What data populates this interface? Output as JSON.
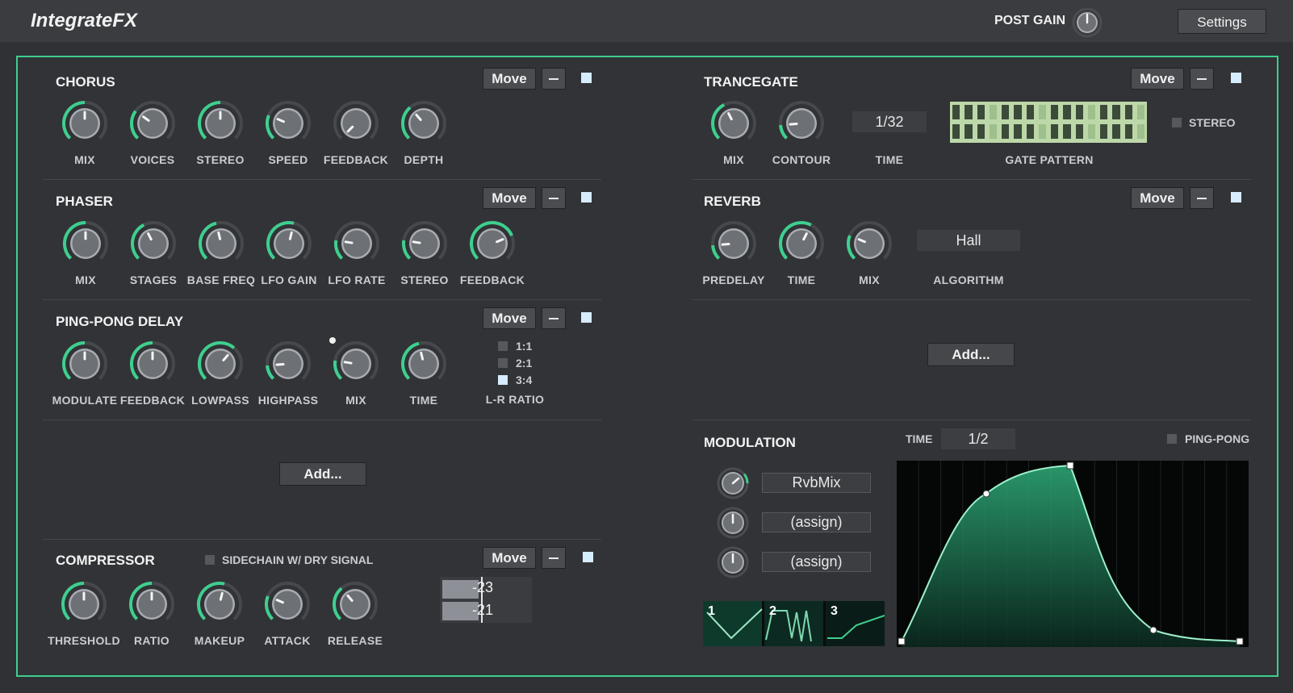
{
  "app": {
    "title": "IntegrateFX",
    "post_gain_label": "POST GAIN",
    "settings_label": "Settings"
  },
  "common": {
    "move_label": "Move",
    "add_label": "Add..."
  },
  "colors": {
    "accent": "#3ecf8e",
    "background": "#313337",
    "panel_border": "#3ecf8e"
  },
  "chorus": {
    "title": "CHORUS",
    "knobs": [
      "MIX",
      "VOICES",
      "STEREO",
      "SPEED",
      "FEEDBACK",
      "DEPTH"
    ],
    "values": [
      0.5,
      0.3,
      0.5,
      0.25,
      0.0,
      0.35
    ]
  },
  "phaser": {
    "title": "PHASER",
    "knobs": [
      "MIX",
      "STAGES",
      "BASE FREQ",
      "LFO GAIN",
      "LFO RATE",
      "STEREO",
      "FEEDBACK"
    ],
    "values": [
      0.5,
      0.4,
      0.45,
      0.55,
      0.2,
      0.2,
      0.75
    ]
  },
  "pingpong": {
    "title": "PING-PONG DELAY",
    "knobs": [
      "MODULATE",
      "FEEDBACK",
      "LOWPASS",
      "HIGHPASS",
      "MIX",
      "TIME"
    ],
    "values": [
      0.5,
      0.5,
      0.65,
      0.15,
      0.2,
      0.45
    ],
    "ratio_options": [
      "1:1",
      "2:1",
      "3:4"
    ],
    "ratio_selected": "3:4",
    "ratio_label": "L-R RATIO"
  },
  "compressor": {
    "title": "COMPRESSOR",
    "sidechain_label": "SIDECHAIN W/ DRY SIGNAL",
    "knobs": [
      "THRESHOLD",
      "RATIO",
      "MAKEUP",
      "ATTACK",
      "RELEASE"
    ],
    "values": [
      0.5,
      0.5,
      0.55,
      0.25,
      0.35
    ],
    "meter_values": [
      "-23",
      "-21"
    ]
  },
  "trancegate": {
    "title": "TRANCEGATE",
    "knobs": [
      "MIX",
      "CONTOUR"
    ],
    "values": [
      0.4,
      0.15
    ],
    "time_value": "1/32",
    "time_label": "TIME",
    "pattern_label": "GATE PATTERN",
    "stereo_label": "STEREO"
  },
  "reverb": {
    "title": "REVERB",
    "knobs": [
      "PREDELAY",
      "TIME",
      "MIX"
    ],
    "values": [
      0.15,
      0.6,
      0.25
    ],
    "algorithm_value": "Hall",
    "algorithm_label": "ALGORITHM"
  },
  "modulation": {
    "title": "MODULATION",
    "time_label": "TIME",
    "time_value": "1/2",
    "pingpong_label": "PING-PONG",
    "targets": [
      "RvbMix",
      "(assign)",
      "(assign)"
    ],
    "shape_tabs": [
      "1",
      "2",
      "3"
    ]
  }
}
